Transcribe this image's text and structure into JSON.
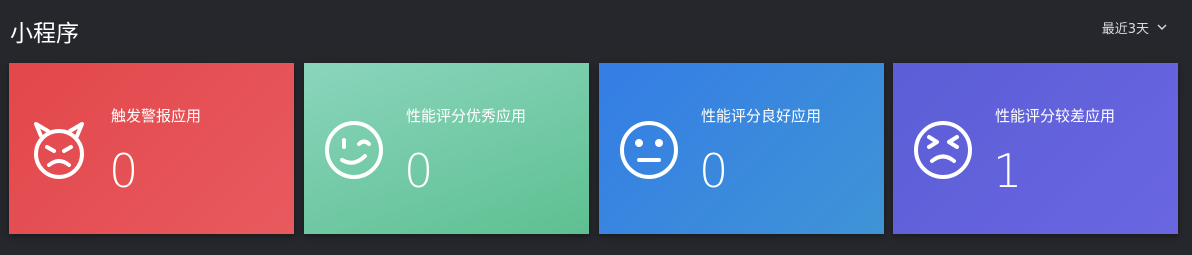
{
  "header": {
    "title": "小程序",
    "range_label": "最近3天"
  },
  "cards": [
    {
      "label": "触发警报应用",
      "count": "0",
      "icon": "devil-face-icon",
      "color": "#e44e53"
    },
    {
      "label": "性能评分优秀应用",
      "count": "0",
      "icon": "wink-face-icon",
      "color": "#6fcaa2"
    },
    {
      "label": "性能评分良好应用",
      "count": "0",
      "icon": "neutral-face-icon",
      "color": "#3886df"
    },
    {
      "label": "性能评分较差应用",
      "count": "1",
      "icon": "squint-face-icon",
      "color": "#6162dc"
    }
  ]
}
